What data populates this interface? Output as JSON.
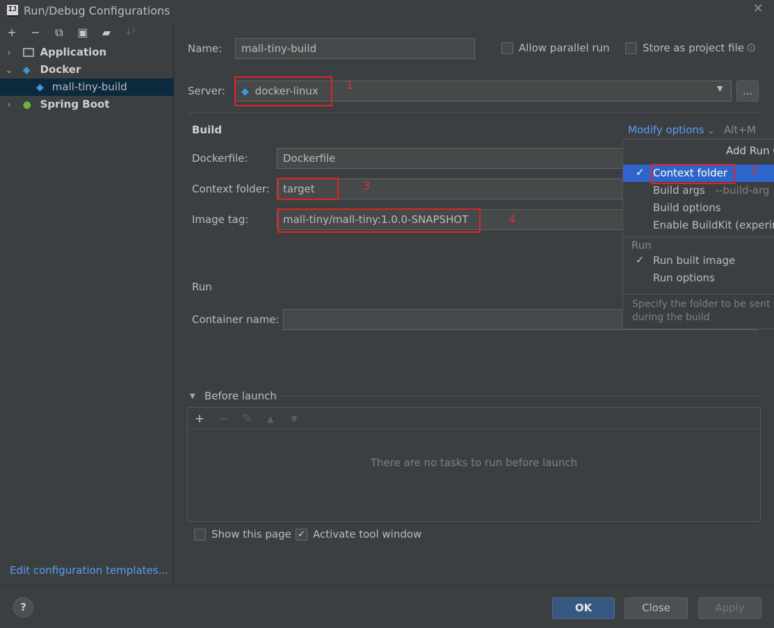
{
  "window": {
    "title": "Run/Debug Configurations"
  },
  "toolbar": {
    "add": "+",
    "remove": "−",
    "copy": "⧉",
    "save": "▣",
    "folder": "▰",
    "sort": "↓²"
  },
  "tree": {
    "items": [
      {
        "label": "Application",
        "icon": "application-icon"
      },
      {
        "label": "Docker",
        "icon": "docker-icon"
      },
      {
        "label": "mall-tiny-build",
        "icon": "docker-config-icon"
      },
      {
        "label": "Spring Boot",
        "icon": "spring-boot-icon"
      }
    ],
    "edit_templates": "Edit configuration templates..."
  },
  "form": {
    "name_label": "Name:",
    "name_value": "mall-tiny-build",
    "allow_parallel": "Allow parallel run",
    "store_project": "Store as project file",
    "server_label": "Server:",
    "server_value": "docker-linux",
    "more_btn": "...",
    "build_header": "Build",
    "modify_options": "Modify options",
    "shortcut": "Alt+M",
    "dockerfile_label": "Dockerfile:",
    "dockerfile_value": "Dockerfile",
    "context_label": "Context folder:",
    "context_value": "target",
    "image_label": "Image tag:",
    "image_value": "mall-tiny/mall-tiny:1.0.0-SNAPSHOT",
    "run_header": "Run",
    "container_label": "Container name:",
    "container_value": "",
    "before_launch": "Before launch",
    "no_tasks": "There are no tasks to run before launch",
    "show_page": "Show this page",
    "activate_tool": "Activate tool window"
  },
  "annotations": [
    "1",
    "2",
    "3",
    "4"
  ],
  "popup": {
    "header": "Add Run Options",
    "items": [
      {
        "label": "Context folder",
        "checked": true
      },
      {
        "label": "Build args",
        "hint": "--build-arg"
      },
      {
        "label": "Build options"
      },
      {
        "label": "Enable BuildKit (experimental)"
      }
    ],
    "run_section": "Run",
    "run_items": [
      {
        "label": "Run built image",
        "checked": true
      },
      {
        "label": "Run options"
      }
    ],
    "description_1": "Specify the folder to be sent to",
    "description_2": "during the build"
  },
  "footer": {
    "help": "?",
    "ok": "OK",
    "close": "Close",
    "apply": "Apply"
  }
}
